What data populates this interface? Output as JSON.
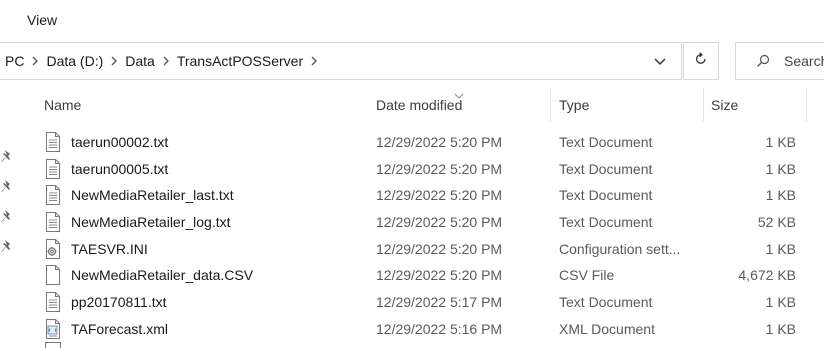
{
  "ribbon": {
    "view_label": "View"
  },
  "address": {
    "crumbs": [
      "PC",
      "Data (D:)",
      "Data",
      "TransActPOSServer"
    ]
  },
  "search": {
    "placeholder": "Search"
  },
  "columns": {
    "name": "Name",
    "date": "Date modified",
    "type": "Type",
    "size": "Size"
  },
  "files": [
    {
      "name": "taerun00002.txt",
      "date": "12/29/2022 5:20 PM",
      "type": "Text Document",
      "size": "1 KB",
      "icon": "text-file-icon"
    },
    {
      "name": "taerun00005.txt",
      "date": "12/29/2022 5:20 PM",
      "type": "Text Document",
      "size": "1 KB",
      "icon": "text-file-icon"
    },
    {
      "name": "NewMediaRetailer_last.txt",
      "date": "12/29/2022 5:20 PM",
      "type": "Text Document",
      "size": "1 KB",
      "icon": "text-file-icon"
    },
    {
      "name": "NewMediaRetailer_log.txt",
      "date": "12/29/2022 5:20 PM",
      "type": "Text Document",
      "size": "52 KB",
      "icon": "text-file-icon"
    },
    {
      "name": "TAESVR.INI",
      "date": "12/29/2022 5:20 PM",
      "type": "Configuration sett...",
      "size": "1 KB",
      "icon": "config-file-icon"
    },
    {
      "name": "NewMediaRetailer_data.CSV",
      "date": "12/29/2022 5:20 PM",
      "type": "CSV File",
      "size": "4,672 KB",
      "icon": "blank-file-icon"
    },
    {
      "name": "pp20170811.txt",
      "date": "12/29/2022 5:17 PM",
      "type": "Text Document",
      "size": "1 KB",
      "icon": "text-file-icon"
    },
    {
      "name": "TAForecast.xml",
      "date": "12/29/2022 5:16 PM",
      "type": "XML Document",
      "size": "1 KB",
      "icon": "xml-file-icon"
    }
  ]
}
